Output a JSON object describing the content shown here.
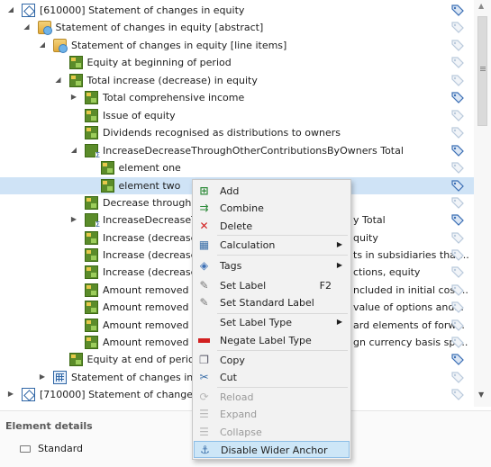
{
  "tree": {
    "rows": [
      {
        "text": "[610000] Statement of changes in equity",
        "icon": "role-icon",
        "arrow": "expanded"
      },
      {
        "text": "Statement of changes in equity [abstract]",
        "icon": "folder-icon",
        "arrow": "expanded"
      },
      {
        "text": "Statement of changes in equity [line items]",
        "icon": "folder-icon",
        "arrow": "expanded"
      },
      {
        "text": "Equity at beginning of period",
        "icon": "element-icon",
        "arrow": ""
      },
      {
        "text": "Total increase (decrease) in equity",
        "icon": "element-icon",
        "arrow": "expanded"
      },
      {
        "text": "Total comprehensive income",
        "icon": "element-icon",
        "arrow": "collapsed"
      },
      {
        "text": "Issue of equity",
        "icon": "element-icon",
        "arrow": ""
      },
      {
        "text": "Dividends recognised as distributions to owners",
        "icon": "element-icon",
        "arrow": ""
      },
      {
        "text": "IncreaseDecreaseThroughOtherContributionsByOwners Total",
        "icon": "summation-icon",
        "arrow": "expanded"
      },
      {
        "text": "element one",
        "icon": "element-icon",
        "arrow": ""
      },
      {
        "text": "element two",
        "icon": "element-icon",
        "arrow": ""
      },
      {
        "text": "Decrease through c",
        "icon": "element-icon",
        "arrow": ""
      },
      {
        "text": "IncreaseDecreaseTh",
        "suffix": "y Total",
        "icon": "summation-icon",
        "arrow": "collapsed"
      },
      {
        "text": "Increase (decrease)",
        "suffix": "quity",
        "icon": "element-icon",
        "arrow": ""
      },
      {
        "text": "Increase (decrease)",
        "suffix": "ts in subsidiaries that...",
        "icon": "element-icon",
        "arrow": ""
      },
      {
        "text": "Increase (decrease)",
        "suffix": "ctions, equity",
        "icon": "element-icon",
        "arrow": ""
      },
      {
        "text": "Amount removed fr",
        "suffix": "ncluded in initial cost...",
        "icon": "element-icon",
        "arrow": ""
      },
      {
        "text": "Amount removed fr",
        "suffix": "value of options and...",
        "icon": "element-icon",
        "arrow": ""
      },
      {
        "text": "Amount removed fr",
        "suffix": "ard elements of forw...",
        "icon": "element-icon",
        "arrow": ""
      },
      {
        "text": "Amount removed fr",
        "suffix": "gn currency basis spr...",
        "icon": "element-icon",
        "arrow": ""
      },
      {
        "text": "Equity at end of period",
        "icon": "element-icon",
        "arrow": ""
      },
      {
        "text": "Statement of changes in eq",
        "icon": "hypercube-icon",
        "arrow": "collapsed"
      },
      {
        "text": "[710000] Statement of changes in",
        "icon": "role-icon",
        "arrow": "collapsed"
      }
    ],
    "selected_index": 10
  },
  "details": {
    "title": "Element details",
    "standard_label": "Standard"
  },
  "context_menu": {
    "items": [
      {
        "label": "Add",
        "icon": "add-icon",
        "enabled": true
      },
      {
        "label": "Combine",
        "icon": "combine-icon",
        "enabled": true
      },
      {
        "label": "Delete",
        "icon": "delete-icon",
        "enabled": true
      },
      {
        "label": "Calculation",
        "icon": "calculation-icon",
        "enabled": true,
        "submenu": true
      },
      {
        "label": "Tags",
        "icon": "tags-icon",
        "enabled": true,
        "submenu": true
      },
      {
        "label": "Set Label",
        "icon": "set-label-icon",
        "enabled": true,
        "shortcut": "F2"
      },
      {
        "label": "Set Standard Label",
        "icon": "set-standard-label-icon",
        "enabled": true
      },
      {
        "label": "Set Label Type",
        "icon": "",
        "enabled": true,
        "submenu": true
      },
      {
        "label": "Negate Label Type",
        "icon": "negate-icon",
        "enabled": true
      },
      {
        "label": "Copy",
        "icon": "copy-icon",
        "enabled": true
      },
      {
        "label": "Cut",
        "icon": "cut-icon",
        "enabled": true
      },
      {
        "label": "Reload",
        "icon": "reload-icon",
        "enabled": false
      },
      {
        "label": "Expand",
        "icon": "expand-icon",
        "enabled": false
      },
      {
        "label": "Collapse",
        "icon": "collapse-icon",
        "enabled": false
      },
      {
        "label": "Disable Wider Anchor",
        "icon": "anchor-icon",
        "enabled": true,
        "highlighted": true
      }
    ]
  },
  "colors": {
    "selection": "#cfe3f6",
    "menu_highlight": "#cde6f7",
    "tag_blue": "#3b6fb5",
    "tag_light": "#b9c9dc"
  }
}
